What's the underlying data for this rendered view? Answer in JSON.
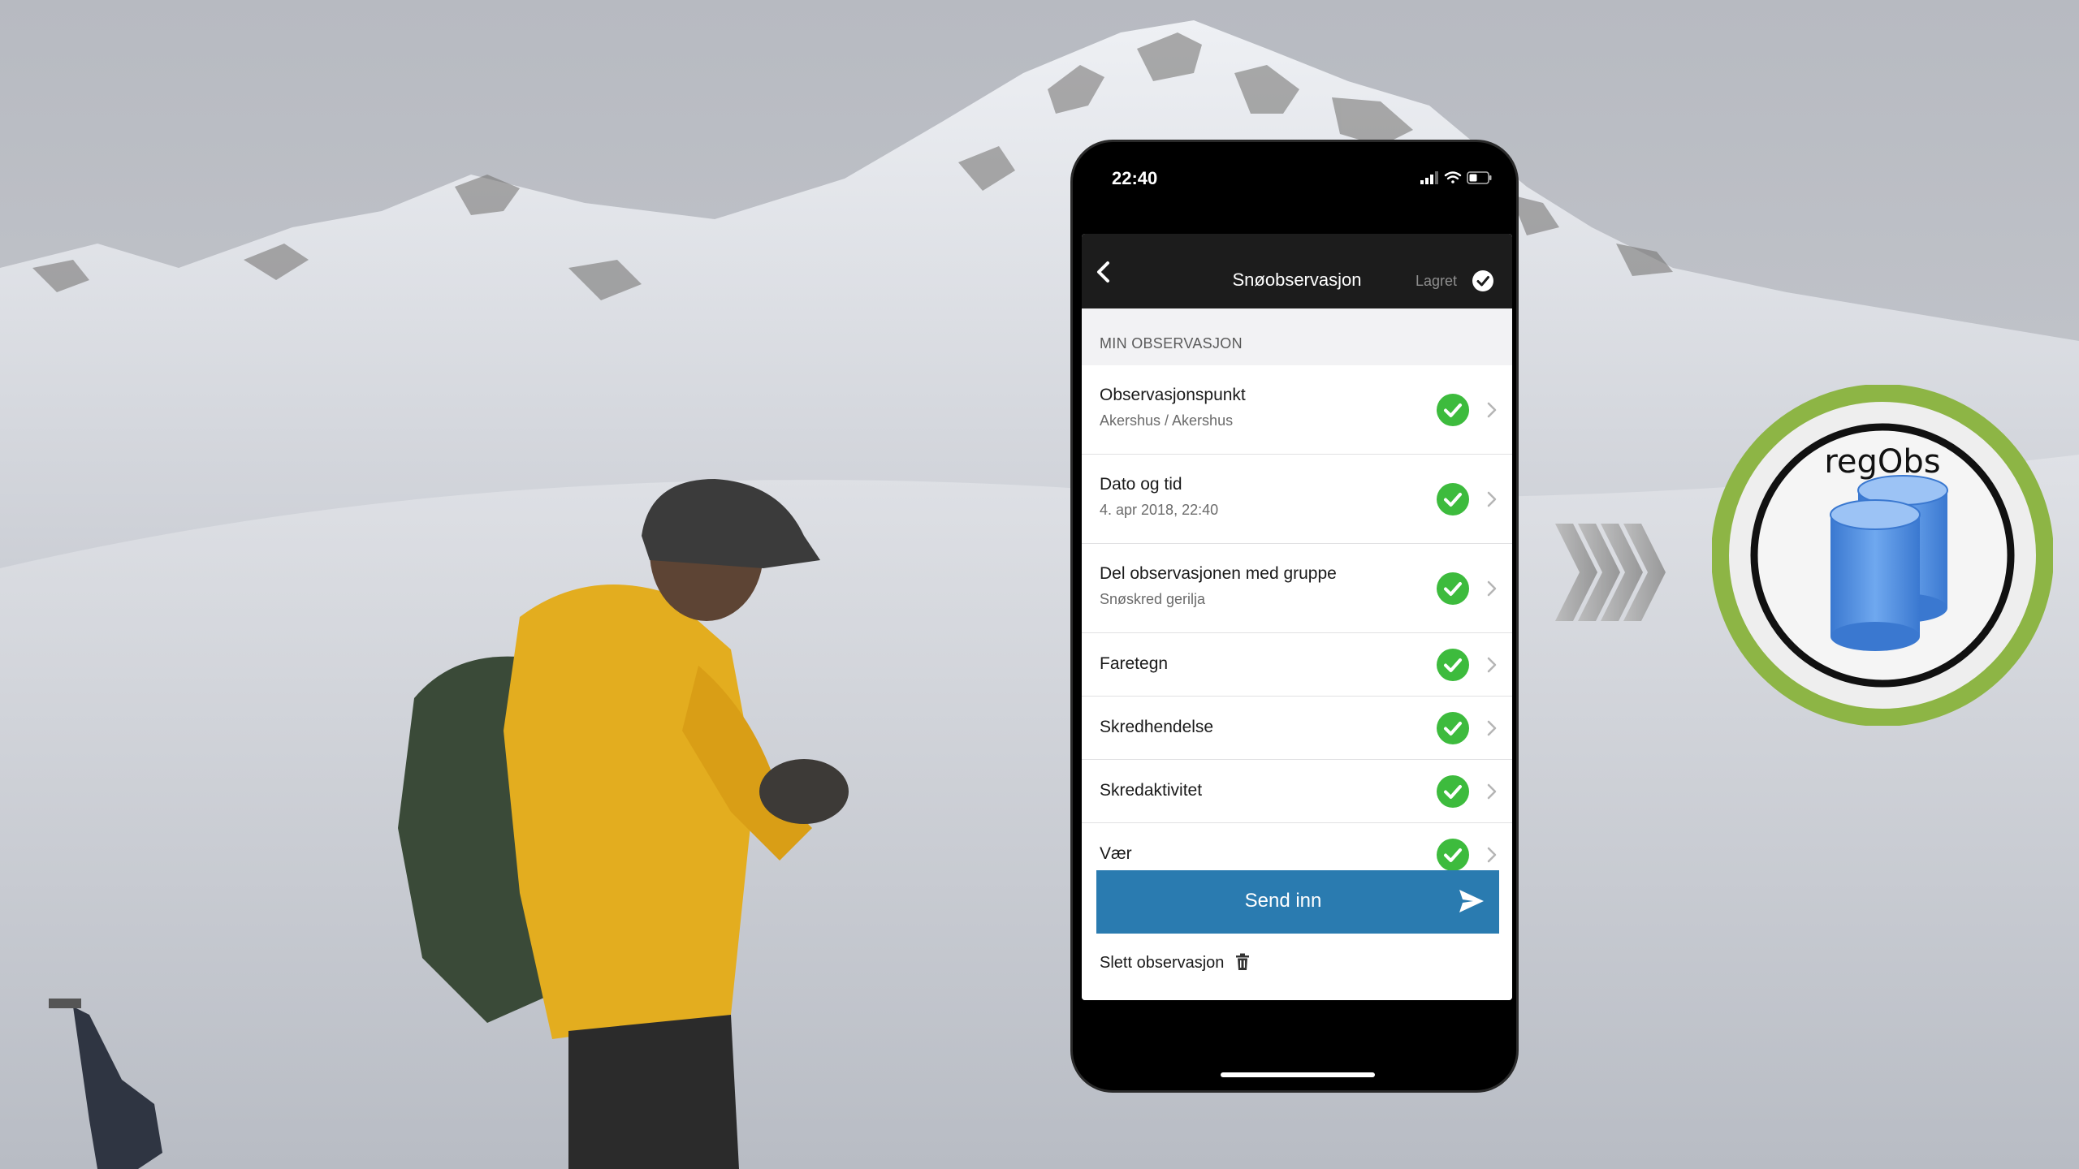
{
  "status_bar": {
    "time": "22:40",
    "icons": [
      "signal-icon",
      "wifi-icon",
      "battery-icon"
    ]
  },
  "nav": {
    "title": "Snøobservasjon",
    "saved_label": "Lagret",
    "icons": [
      "back-chevron-icon",
      "saved-check-icon"
    ]
  },
  "section": {
    "header": "MIN OBSERVASJON"
  },
  "rows": [
    {
      "title": "Observasjonspunkt",
      "subtitle": "Akershus / Akershus"
    },
    {
      "title": "Dato og tid",
      "subtitle": "4. apr 2018, 22:40"
    },
    {
      "title": "Del observasjonen med gruppe",
      "subtitle": "Snøskred gerilja"
    },
    {
      "title": "Faretegn"
    },
    {
      "title": "Skredhendelse"
    },
    {
      "title": "Skredaktivitet"
    },
    {
      "title": "Vær"
    }
  ],
  "footer": {
    "send_label": "Send inn",
    "delete_label": "Slett observasjon",
    "icons": [
      "send-icon",
      "trash-icon"
    ]
  },
  "logo": {
    "text": "regObs"
  },
  "colors": {
    "nav_bg": "#1c1c1c",
    "check_green": "#3dbb3d",
    "send_button": "#2a7bb0",
    "logo_ring_green": "#8db545",
    "logo_db_blue": "#4a8fe0"
  }
}
